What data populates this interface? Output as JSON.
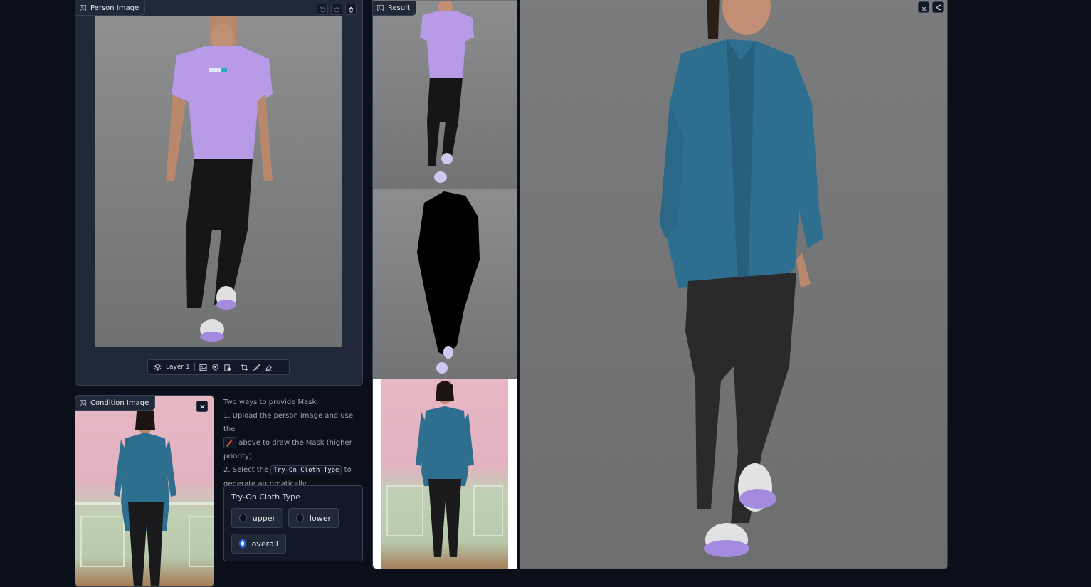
{
  "person_panel": {
    "label": "Person Image",
    "buttons": [
      "undo-icon",
      "redo-icon",
      "trash-icon"
    ],
    "toolbar": {
      "layer_label": "Layer 1"
    }
  },
  "condition_panel": {
    "label": "Condition Image"
  },
  "instructions": {
    "line1": "Two ways to provide Mask:",
    "line2a": "1. Upload the person image and use the",
    "line2b": "above to draw the Mask (higher priority)",
    "line3a": "2. Select the",
    "line3_code": "Try-On Cloth Type",
    "line3b": "to generate automatically"
  },
  "cloth_type": {
    "title": "Try-On Cloth Type",
    "options": [
      "upper",
      "lower",
      "overall"
    ],
    "selected": "overall"
  },
  "result_panel": {
    "label": "Result",
    "buttons": [
      "download-icon",
      "share-icon"
    ]
  },
  "colors": {
    "background": "#0b0f19",
    "panel": "#1f2937",
    "accent": "#2563eb",
    "shirt": "#2e6e8e",
    "tee": "#b79be6"
  }
}
